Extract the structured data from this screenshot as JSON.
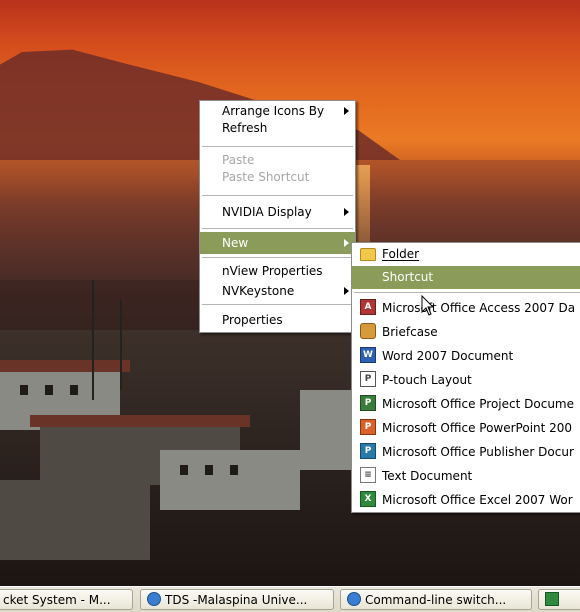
{
  "context_menu": {
    "items": [
      {
        "label": "Arrange Icons By",
        "submenu": true
      },
      {
        "label": "Refresh"
      },
      {
        "label": "Paste",
        "disabled": true
      },
      {
        "label": "Paste Shortcut",
        "disabled": true
      },
      {
        "label": "NVIDIA Display",
        "submenu": true
      },
      {
        "label": "New",
        "submenu": true,
        "highlighted": true
      },
      {
        "label": "nView Properties"
      },
      {
        "label": "NVKeystone",
        "submenu": true
      },
      {
        "label": "Properties"
      }
    ]
  },
  "new_submenu": {
    "items": [
      {
        "label": "Folder",
        "icon": "folder-icon"
      },
      {
        "label": "Shortcut",
        "highlighted": true
      },
      {
        "label": "Microsoft Office Access 2007 Da",
        "icon": "access-icon"
      },
      {
        "label": "Briefcase",
        "icon": "briefcase-icon"
      },
      {
        "label": "Word 2007 Document",
        "icon": "word-icon"
      },
      {
        "label": "P-touch Layout",
        "icon": "ptouch-icon"
      },
      {
        "label": "Microsoft Office Project Docume",
        "icon": "project-icon"
      },
      {
        "label": "Microsoft Office PowerPoint 200",
        "icon": "powerpoint-icon"
      },
      {
        "label": "Microsoft Office Publisher Docur",
        "icon": "publisher-icon"
      },
      {
        "label": "Text Document",
        "icon": "text-document-icon"
      },
      {
        "label": "Microsoft Office Excel 2007 Wor",
        "icon": "excel-icon"
      }
    ]
  },
  "taskbar": {
    "buttons": [
      {
        "label": "cket System - M...",
        "icon": null
      },
      {
        "label": "TDS -Malaspina Unive...",
        "icon": "ie-icon"
      },
      {
        "label": "Command-line switch...",
        "icon": "ie-icon"
      },
      {
        "label": "",
        "icon": "excel-icon"
      }
    ]
  },
  "colors": {
    "menu_highlight": "#8b9c5a",
    "taskbar": "#eae8dc"
  }
}
